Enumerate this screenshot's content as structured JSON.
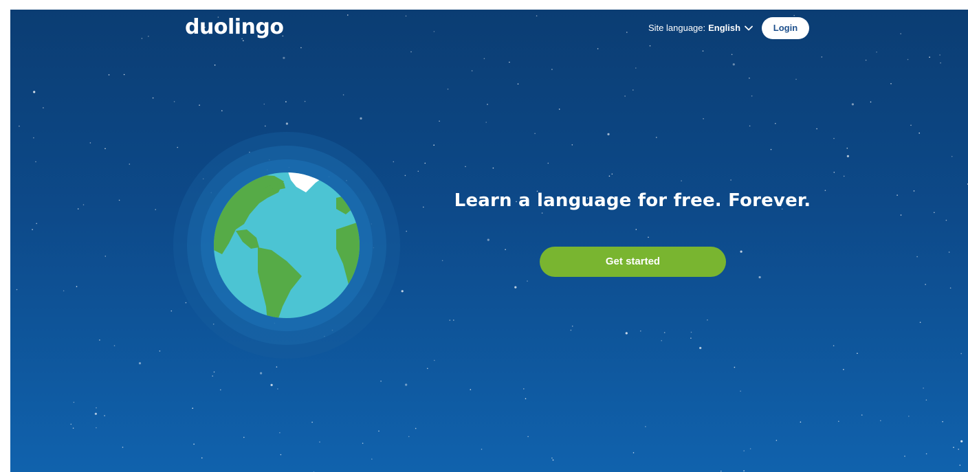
{
  "header": {
    "logo_text": "duolingo",
    "site_language_prefix": "Site language:",
    "site_language_value": "English",
    "login_label": "Login"
  },
  "hero": {
    "headline": "Learn a language for free. Forever.",
    "cta_label": "Get started"
  },
  "icons": {
    "globe": "globe-icon",
    "chevron": "chevron-down-icon"
  },
  "colors": {
    "background_top": "#0b3d73",
    "background_bottom": "#1062ad",
    "cta_green": "#79b530",
    "login_text": "#1c4f8c",
    "ocean": "#4cc4d3",
    "land": "#56ab47"
  }
}
